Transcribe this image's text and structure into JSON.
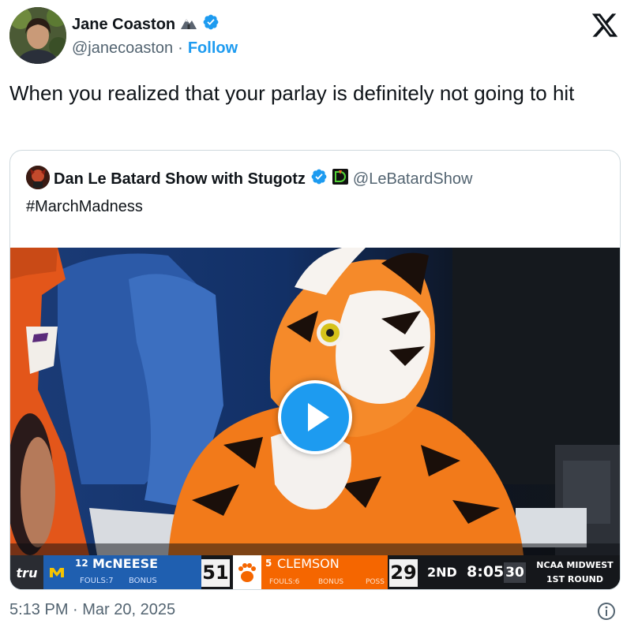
{
  "author": {
    "name": "Jane Coaston",
    "handle": "@janecoaston",
    "separator": "·",
    "follow_label": "Follow",
    "name_emoji_icon": "mountain-icon",
    "verified_icon": "verified-badge-icon"
  },
  "brand": {
    "logo_icon": "x-logo-icon"
  },
  "tweet": {
    "text": "When you realized that your parlay is definitely not going to hit",
    "timestamp": "5:13 PM · Mar 20, 2025"
  },
  "quoted": {
    "name": "Dan Le Batard Show with Stugotz",
    "handle": "@LeBatardShow",
    "text": "#MarchMadness",
    "affiliate_icon": "draftkings-logo-icon",
    "media": {
      "type": "video",
      "play_icon": "play-icon",
      "scoreboard": {
        "network": "tru",
        "team1": {
          "seed": "12",
          "name": "McNEESE",
          "fouls": "FOULS:7",
          "bonus": "BONUS",
          "score": "51"
        },
        "team2": {
          "seed": "5",
          "name": "CLEMSON",
          "fouls": "FOULS:6",
          "bonus": "BONUS",
          "poss": "POSS",
          "score": "29"
        },
        "period": "2ND",
        "clock": "8:05",
        "shot_clock": "30",
        "region": "NCAA MIDWEST",
        "round": "1ST ROUND"
      }
    }
  },
  "colors": {
    "accent": "#1d9bf0",
    "text": "#0f1419",
    "muted": "#536471",
    "border": "#cfd9de",
    "mcneese_blue": "#1f5fb0",
    "clemson_orange": "#f56600"
  }
}
